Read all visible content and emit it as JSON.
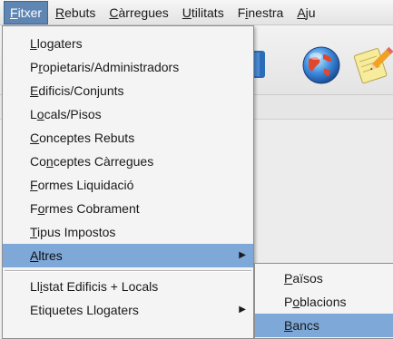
{
  "menubar": {
    "items": [
      {
        "pre": "",
        "mn": "F",
        "post": "itxer"
      },
      {
        "pre": "",
        "mn": "R",
        "post": "ebuts"
      },
      {
        "pre": "",
        "mn": "C",
        "post": "àrregues"
      },
      {
        "pre": "",
        "mn": "U",
        "post": "tilitats"
      },
      {
        "pre": "F",
        "mn": "i",
        "post": "nestra"
      },
      {
        "pre": "",
        "mn": "A",
        "post": "ju"
      }
    ]
  },
  "fitxer_menu": {
    "items": [
      {
        "pre": "",
        "mn": "L",
        "post": "logaters"
      },
      {
        "pre": "P",
        "mn": "r",
        "post": "opietaris/Administradors"
      },
      {
        "pre": "",
        "mn": "E",
        "post": "dificis/Conjunts"
      },
      {
        "pre": "L",
        "mn": "o",
        "post": "cals/Pisos"
      },
      {
        "pre": "",
        "mn": "C",
        "post": "onceptes Rebuts"
      },
      {
        "pre": "Co",
        "mn": "n",
        "post": "ceptes Càrregues"
      },
      {
        "pre": "",
        "mn": "F",
        "post": "ormes Liquidació"
      },
      {
        "pre": "F",
        "mn": "o",
        "post": "rmes Cobrament"
      },
      {
        "pre": "",
        "mn": "T",
        "post": "ipus Impostos"
      },
      {
        "pre": "",
        "mn": "A",
        "post": "ltres"
      },
      {
        "pre": "Ll",
        "mn": "i",
        "post": "stat Edificis + Locals"
      },
      {
        "pre": "Etiquetes Llogaters",
        "mn": "",
        "post": ""
      }
    ]
  },
  "altres_submenu": {
    "items": [
      {
        "pre": "",
        "mn": "P",
        "post": "aïsos"
      },
      {
        "pre": "P",
        "mn": "o",
        "post": "blacions"
      },
      {
        "pre": "",
        "mn": "B",
        "post": "ancs"
      }
    ]
  },
  "colors": {
    "highlight": "#7ea8d8",
    "active_menu": "#5f86b3"
  },
  "icons": [
    "document-icon",
    "globe-icon",
    "notepad-pencil-icon"
  ]
}
